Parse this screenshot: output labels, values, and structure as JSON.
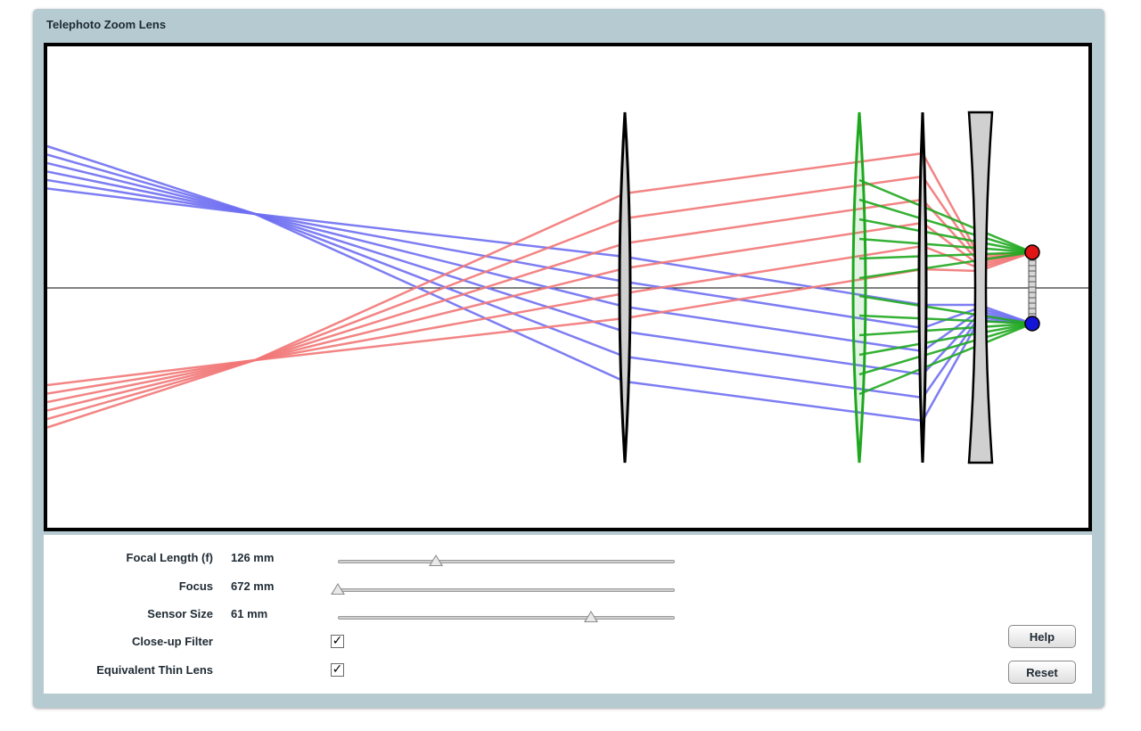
{
  "app": {
    "title": "Telephoto Zoom Lens"
  },
  "controls": {
    "focal_length": {
      "label": "Focal Length (f)",
      "value": "126 mm",
      "slider_fraction": 0.29
    },
    "focus": {
      "label": "Focus",
      "value": "672 mm",
      "slider_fraction": 0.0
    },
    "sensor_size": {
      "label": "Sensor Size",
      "value": "61 mm",
      "slider_fraction": 0.75
    },
    "closeup_filter": {
      "label": "Close-up Filter",
      "checked": true,
      "mark": "✓"
    },
    "thin_lens": {
      "label": "Equivalent Thin Lens",
      "checked": true,
      "mark": "✓"
    }
  },
  "buttons": {
    "help": "Help",
    "reset": "Reset"
  },
  "colors": {
    "frame": "#b5cad1",
    "ray_blue": "#6f6ff2",
    "ray_red": "#f27777",
    "ray_green": "#1fa81f",
    "lens_fill": "#d0d0d0",
    "sensor_top": "#e01515",
    "sensor_bottom": "#1515d8"
  }
}
